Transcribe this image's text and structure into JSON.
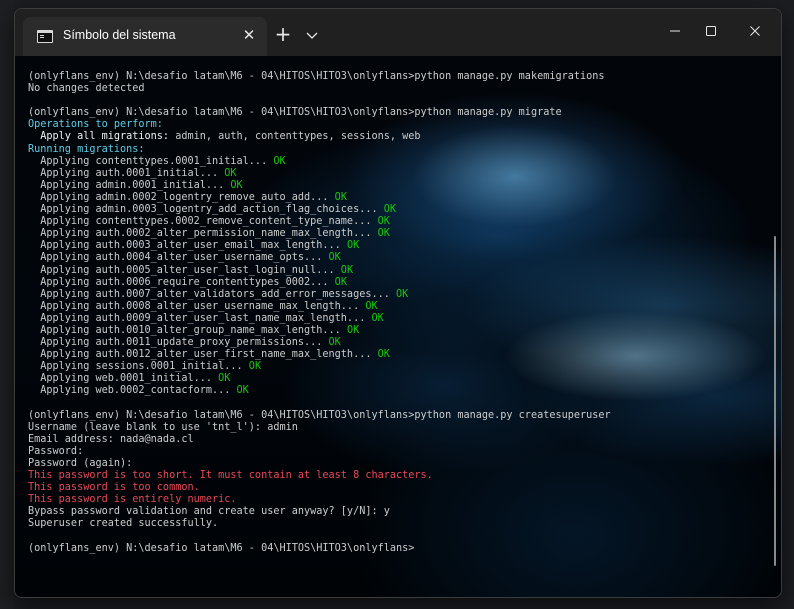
{
  "window": {
    "tab_title": "Símbolo del sistema",
    "tab_icon": "cmd-icon",
    "tab_close": "✕",
    "new_tab": "+",
    "tab_menu": "chevron-down-icon",
    "controls": [
      "minimize-icon",
      "maximize-icon",
      "close-icon"
    ]
  },
  "terminal": {
    "lines": [
      {
        "parts": [
          {
            "t": "(onlyflans_env) N:\\desafio latam\\M6 - 04\\HITOS\\HITO3\\onlyflans>python manage.py makemigrations"
          }
        ]
      },
      {
        "parts": [
          {
            "t": "No changes detected"
          }
        ]
      },
      {
        "parts": [
          {
            "t": ""
          }
        ]
      },
      {
        "parts": [
          {
            "t": "(onlyflans_env) N:\\desafio latam\\M6 - 04\\HITOS\\HITO3\\onlyflans>python manage.py migrate"
          }
        ]
      },
      {
        "parts": [
          {
            "t": "Operations to perform:",
            "c": "cyan"
          }
        ]
      },
      {
        "parts": [
          {
            "t": "  Apply all migrations:",
            "c": "bright"
          },
          {
            "t": " admin, auth, contenttypes, sessions, web"
          }
        ]
      },
      {
        "parts": [
          {
            "t": "Running migrations:",
            "c": "cyan"
          }
        ]
      },
      {
        "parts": [
          {
            "t": "  Applying contenttypes.0001_initial..."
          },
          {
            "t": " OK",
            "c": "ok"
          }
        ]
      },
      {
        "parts": [
          {
            "t": "  Applying auth.0001_initial..."
          },
          {
            "t": " OK",
            "c": "ok"
          }
        ]
      },
      {
        "parts": [
          {
            "t": "  Applying admin.0001_initial..."
          },
          {
            "t": " OK",
            "c": "ok"
          }
        ]
      },
      {
        "parts": [
          {
            "t": "  Applying admin.0002_logentry_remove_auto_add..."
          },
          {
            "t": " OK",
            "c": "ok"
          }
        ]
      },
      {
        "parts": [
          {
            "t": "  Applying admin.0003_logentry_add_action_flag_choices..."
          },
          {
            "t": " OK",
            "c": "ok"
          }
        ]
      },
      {
        "parts": [
          {
            "t": "  Applying contenttypes.0002_remove_content_type_name..."
          },
          {
            "t": " OK",
            "c": "ok"
          }
        ]
      },
      {
        "parts": [
          {
            "t": "  Applying auth.0002_alter_permission_name_max_length..."
          },
          {
            "t": " OK",
            "c": "ok"
          }
        ]
      },
      {
        "parts": [
          {
            "t": "  Applying auth.0003_alter_user_email_max_length..."
          },
          {
            "t": " OK",
            "c": "ok"
          }
        ]
      },
      {
        "parts": [
          {
            "t": "  Applying auth.0004_alter_user_username_opts..."
          },
          {
            "t": " OK",
            "c": "ok"
          }
        ]
      },
      {
        "parts": [
          {
            "t": "  Applying auth.0005_alter_user_last_login_null..."
          },
          {
            "t": " OK",
            "c": "ok"
          }
        ]
      },
      {
        "parts": [
          {
            "t": "  Applying auth.0006_require_contenttypes_0002..."
          },
          {
            "t": " OK",
            "c": "ok"
          }
        ]
      },
      {
        "parts": [
          {
            "t": "  Applying auth.0007_alter_validators_add_error_messages..."
          },
          {
            "t": " OK",
            "c": "ok"
          }
        ]
      },
      {
        "parts": [
          {
            "t": "  Applying auth.0008_alter_user_username_max_length..."
          },
          {
            "t": " OK",
            "c": "ok"
          }
        ]
      },
      {
        "parts": [
          {
            "t": "  Applying auth.0009_alter_user_last_name_max_length..."
          },
          {
            "t": " OK",
            "c": "ok"
          }
        ]
      },
      {
        "parts": [
          {
            "t": "  Applying auth.0010_alter_group_name_max_length..."
          },
          {
            "t": " OK",
            "c": "ok"
          }
        ]
      },
      {
        "parts": [
          {
            "t": "  Applying auth.0011_update_proxy_permissions..."
          },
          {
            "t": " OK",
            "c": "ok"
          }
        ]
      },
      {
        "parts": [
          {
            "t": "  Applying auth.0012_alter_user_first_name_max_length..."
          },
          {
            "t": " OK",
            "c": "ok"
          }
        ]
      },
      {
        "parts": [
          {
            "t": "  Applying sessions.0001_initial..."
          },
          {
            "t": " OK",
            "c": "ok"
          }
        ]
      },
      {
        "parts": [
          {
            "t": "  Applying web.0001_initial..."
          },
          {
            "t": " OK",
            "c": "ok"
          }
        ]
      },
      {
        "parts": [
          {
            "t": "  Applying web.0002_contacform..."
          },
          {
            "t": " OK",
            "c": "ok"
          }
        ]
      },
      {
        "parts": [
          {
            "t": ""
          }
        ]
      },
      {
        "parts": [
          {
            "t": "(onlyflans_env) N:\\desafio latam\\M6 - 04\\HITOS\\HITO3\\onlyflans>python manage.py createsuperuser"
          }
        ]
      },
      {
        "parts": [
          {
            "t": "Username (leave blank to use 'tnt_l'): admin"
          }
        ]
      },
      {
        "parts": [
          {
            "t": "Email address: nada@nada.cl"
          }
        ]
      },
      {
        "parts": [
          {
            "t": "Password:"
          }
        ]
      },
      {
        "parts": [
          {
            "t": "Password (again):"
          }
        ]
      },
      {
        "parts": [
          {
            "t": "This password is too short. It must contain at least 8 characters.",
            "c": "red"
          }
        ]
      },
      {
        "parts": [
          {
            "t": "This password is too common.",
            "c": "red"
          }
        ]
      },
      {
        "parts": [
          {
            "t": "This password is entirely numeric.",
            "c": "red"
          }
        ]
      },
      {
        "parts": [
          {
            "t": "Bypass password validation and create user anyway? [y/N]: y"
          }
        ]
      },
      {
        "parts": [
          {
            "t": "Superuser created successfully."
          }
        ]
      },
      {
        "parts": [
          {
            "t": ""
          }
        ]
      },
      {
        "parts": [
          {
            "t": "(onlyflans_env) N:\\desafio latam\\M6 - 04\\HITOS\\HITO3\\onlyflans>"
          }
        ]
      }
    ]
  },
  "colors": {
    "cyan": "#5ccfe6",
    "ok": "#16c60c",
    "red": "#e74856",
    "text": "#cccccc"
  }
}
